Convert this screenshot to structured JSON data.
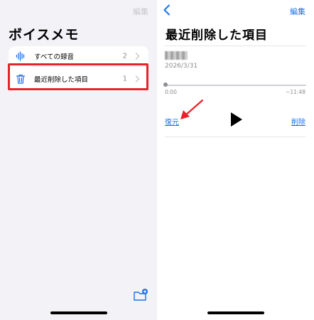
{
  "left": {
    "edit_label": "編集",
    "title": "ボイスメモ",
    "rows": [
      {
        "label": "すべての録音",
        "count": "2",
        "icon": "waveform-icon"
      },
      {
        "label": "最近削除した項目",
        "count": "1",
        "icon": "trash-icon"
      }
    ],
    "folder_icon": "new-folder-icon"
  },
  "right": {
    "back_icon": "chevron-left-icon",
    "edit_label": "編集",
    "title": "最近削除した項目",
    "recording": {
      "date": "2026/3/31",
      "time_start": "0:00",
      "time_end": "−11:48",
      "progress": 0
    },
    "restore_label": "復元",
    "delete_label": "削除",
    "play_icon": "play-icon"
  },
  "colors": {
    "accent": "#1a73e8",
    "highlight": "#e8222b",
    "background": "#f2f2f7"
  }
}
